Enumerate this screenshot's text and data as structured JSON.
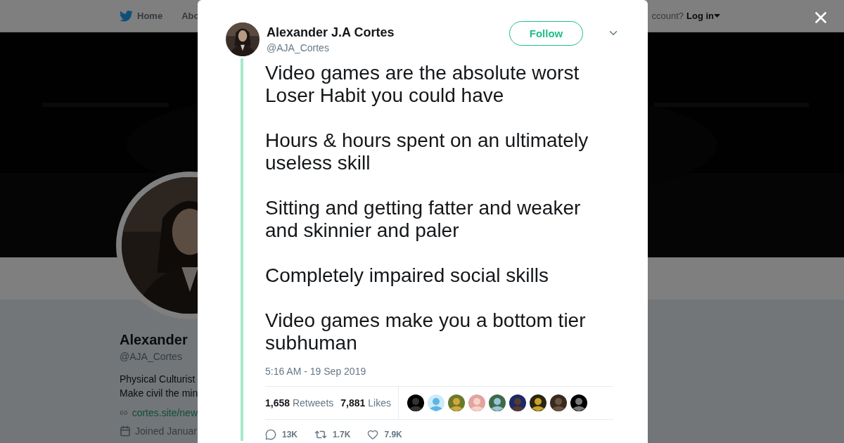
{
  "background_page": {
    "nav": {
      "items": [
        {
          "label": "Home",
          "kind": "home"
        },
        {
          "label": "Abo",
          "kind": "plain"
        }
      ],
      "login_prompt": "ccount?",
      "login": "Log in"
    },
    "profile": {
      "name": "Alexander",
      "handle": "@AJA_Cortes",
      "bio": [
        "Physical Culturist",
        "Make civil the min"
      ],
      "link": "cortes.site/new",
      "joined": "Joined Januar"
    }
  },
  "modal": {
    "author": {
      "name": "Alexander J.A Cortes",
      "handle": "@AJA_Cortes"
    },
    "follow_button": "Follow",
    "tweet": {
      "paragraphs": [
        "Video games are the absolute worst Loser Habit you could have",
        "Hours & hours spent on an ultimately useless skill",
        "Sitting and getting fatter and weaker and skinnier and paler",
        "Completely impaired social skills",
        "Video games make you a bottom tier subhuman"
      ],
      "timestamp": "5:16 AM - 19 Sep 2019",
      "stats": [
        {
          "count": "1,658",
          "label": "Retweets"
        },
        {
          "count": "7,881",
          "label": "Likes"
        }
      ],
      "actions": [
        {
          "kind": "reply",
          "count": "13K"
        },
        {
          "kind": "retweet",
          "count": "1.7K"
        },
        {
          "kind": "like",
          "count": "7.9K"
        }
      ]
    }
  }
}
